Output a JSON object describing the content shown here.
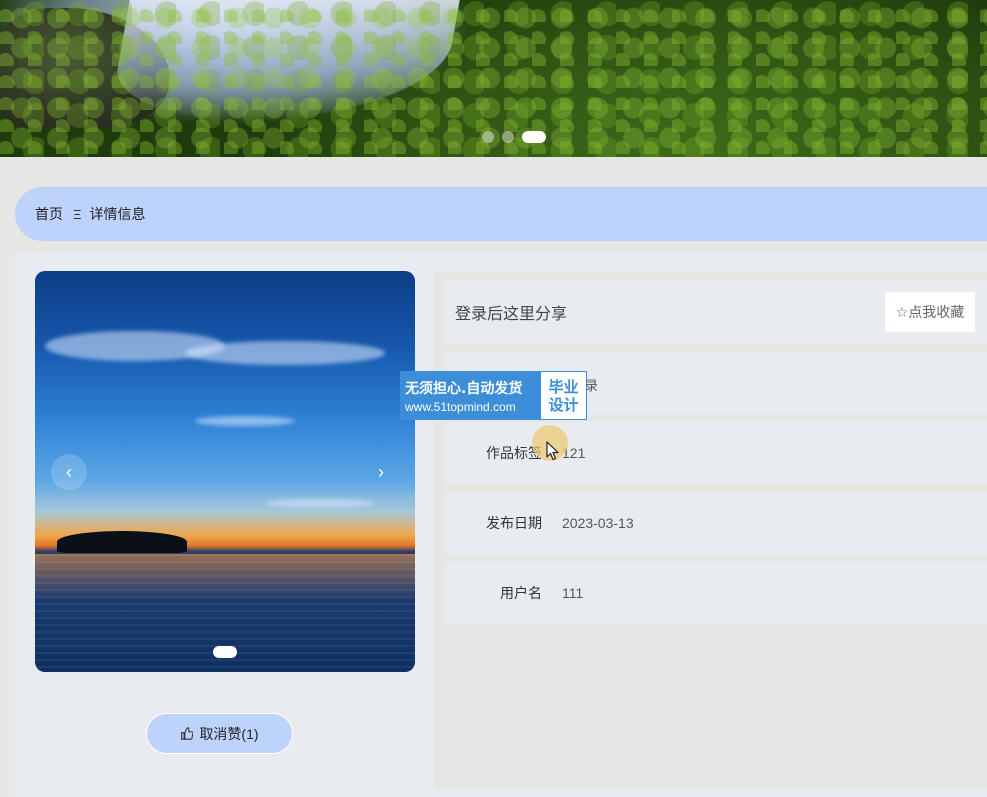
{
  "hero": {
    "slides": [
      {
        "active": false
      },
      {
        "active": false
      },
      {
        "active": true
      }
    ]
  },
  "breadcrumb": {
    "home": "首页",
    "separator": "Ξ",
    "current": "详情信息"
  },
  "gallery": {
    "prev_arrow": "‹",
    "next_arrow": "›"
  },
  "like_button": {
    "icon": "thumbs-up-icon",
    "label": "取消赞(1)"
  },
  "detail": {
    "share_text": "登录后这里分享",
    "collect_button": "☆点我收藏",
    "fields": [
      {
        "label": "作品标签",
        "value": "121"
      },
      {
        "label": "发布日期",
        "value": "2023-03-13"
      },
      {
        "label": "用户名",
        "value": "111"
      }
    ],
    "obscured_row_peek": "录"
  },
  "watermark": {
    "line1": "无须担心.自动发货",
    "line2": "www.51topmind.com",
    "badge_line1": "毕业",
    "badge_line2": "设计"
  },
  "colors": {
    "accent": "#bed3fb",
    "panel": "#e8ecf0",
    "background": "#e6e6e4",
    "watermark": "#3d8ed8"
  }
}
